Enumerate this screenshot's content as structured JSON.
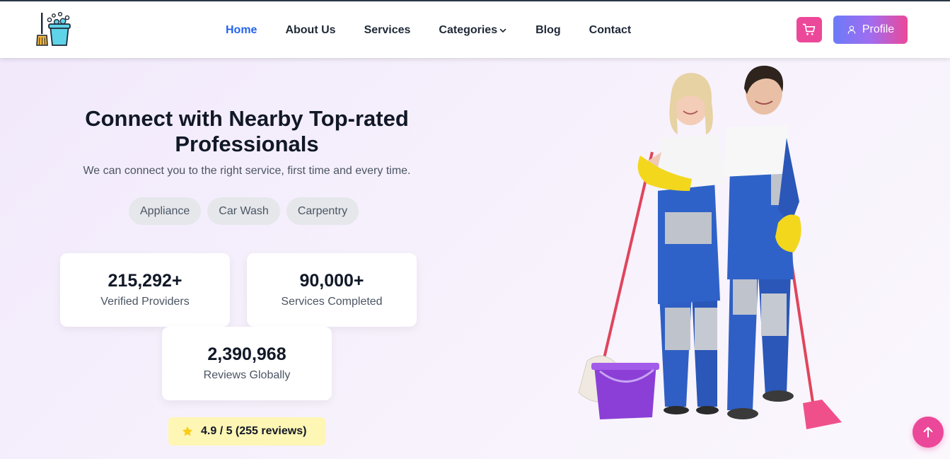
{
  "nav": {
    "items": [
      {
        "label": "Home",
        "active": true
      },
      {
        "label": "About Us"
      },
      {
        "label": "Services"
      },
      {
        "label": "Categories",
        "has_dropdown": true
      },
      {
        "label": "Blog"
      },
      {
        "label": "Contact"
      }
    ]
  },
  "header": {
    "cart_icon": "shopping-cart-icon",
    "profile_label": "Profile",
    "profile_icon": "user-icon"
  },
  "hero": {
    "title_line1": "Connect with Nearby Top-rated",
    "title_line2": "Professionals",
    "subtitle": "We can connect you to the right service, first time and every time.",
    "chips": [
      "Appliance",
      "Car Wash",
      "Carpentry"
    ]
  },
  "stats": [
    {
      "value": "215,292+",
      "label": "Verified Providers"
    },
    {
      "value": "90,000+",
      "label": "Services Completed"
    },
    {
      "value": "2,390,968",
      "label": "Reviews Globally"
    }
  ],
  "rating": {
    "text": "4.9 / 5 (255 reviews)",
    "icon": "star-icon"
  },
  "colors": {
    "accent_blue": "#2563eb",
    "pink": "#ec4899",
    "profile_gradient_start": "#6b7bf7",
    "profile_gradient_end": "#ec4899",
    "rating_bg": "#fef6b4"
  }
}
